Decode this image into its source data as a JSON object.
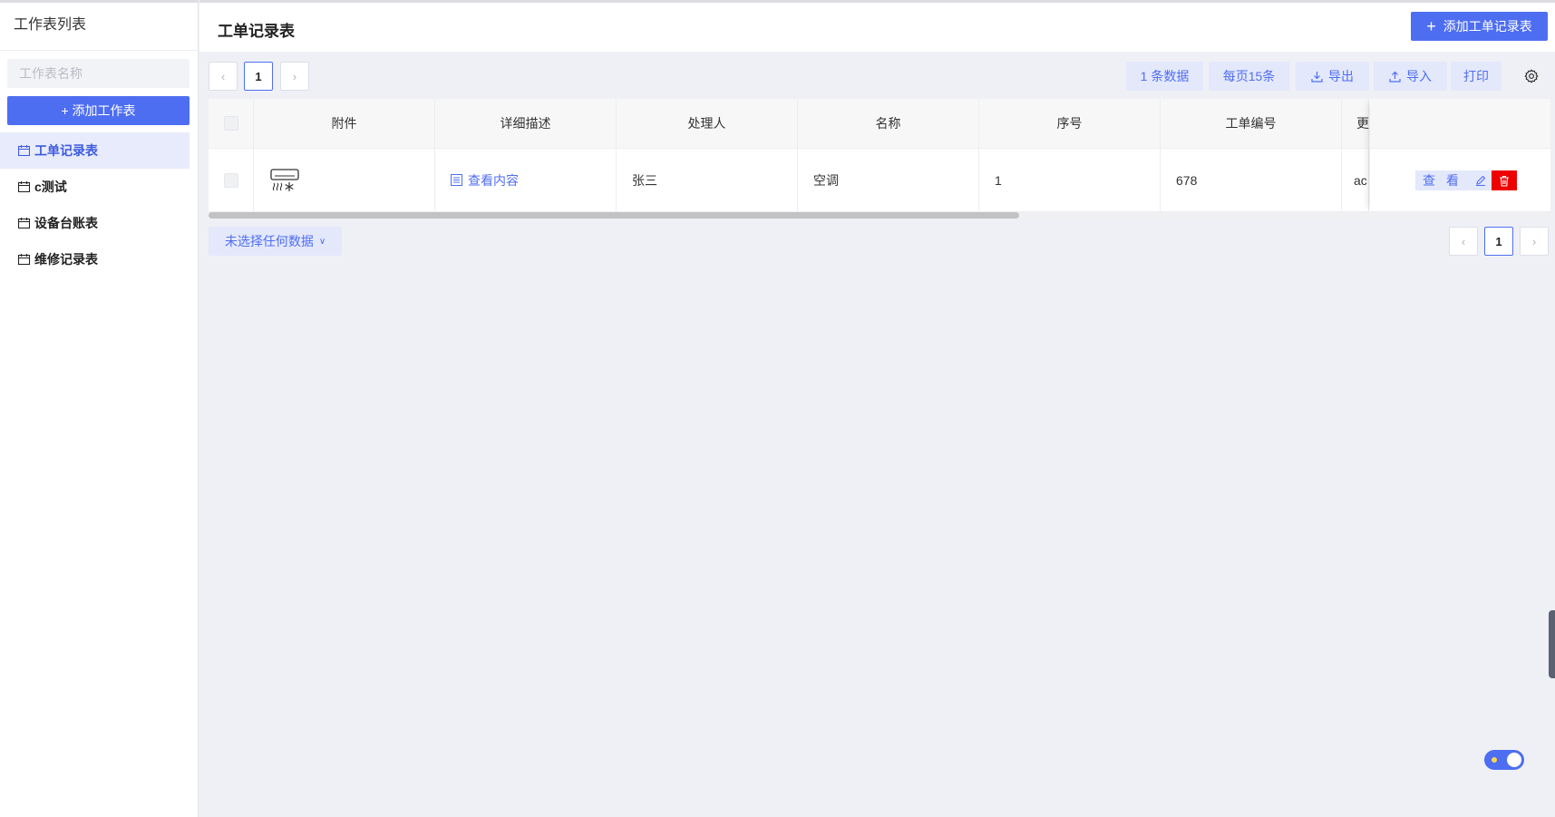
{
  "sidebar": {
    "title": "工作表列表",
    "search_placeholder": "工作表名称",
    "add_label": "+ 添加工作表",
    "items": [
      {
        "label": "工单记录表"
      },
      {
        "label": "c测试"
      },
      {
        "label": "设备台账表"
      },
      {
        "label": "维修记录表"
      }
    ]
  },
  "header": {
    "title": "工单记录表",
    "add_label": "添加工单记录表"
  },
  "toolbar": {
    "current_page": "1",
    "count_label": "1 条数据",
    "page_size_label": "每页15条",
    "export_label": "导出",
    "import_label": "导入",
    "print_label": "打印"
  },
  "table": {
    "columns": [
      "附件",
      "详细描述",
      "处理人",
      "名称",
      "序号",
      "工单编号",
      "更"
    ],
    "rows": [
      {
        "attachment_icon": "air-conditioner-icon",
        "description_link": "查看内容",
        "handler": "张三",
        "name": "空调",
        "seq": "1",
        "order_no": "678",
        "more": "ac",
        "view_label": "查 看"
      }
    ]
  },
  "footer": {
    "selection_label": "未选择任何数据",
    "current_page": "1"
  },
  "colors": {
    "accent": "#4e6ef2",
    "accent_light": "#e4e8fb",
    "danger": "#ee0000",
    "background": "#eff0f5"
  }
}
